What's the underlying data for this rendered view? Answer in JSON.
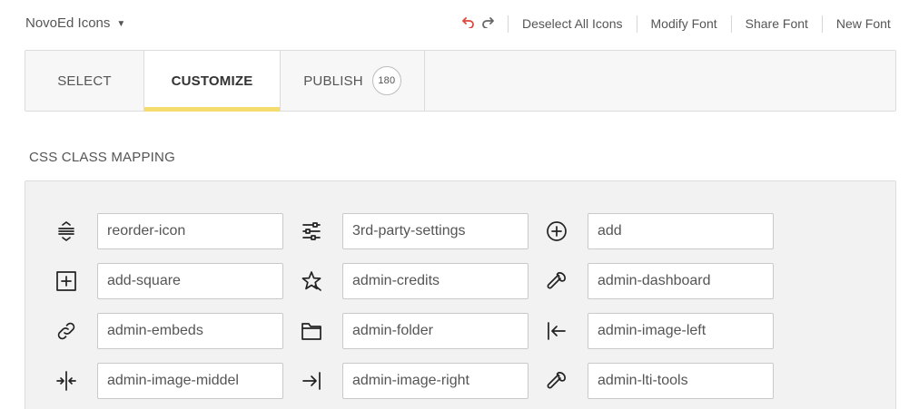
{
  "header": {
    "font_name": "NovoEd Icons",
    "menu": [
      "Deselect All Icons",
      "Modify Font",
      "Share Font",
      "New Font"
    ]
  },
  "colors": {
    "accent": "#f5dc6e",
    "undo": "#e0463c"
  },
  "tabs": {
    "select": "SELECT",
    "customize": "CUSTOMIZE",
    "publish": "PUBLISH",
    "publish_count": "180"
  },
  "mapping": {
    "title": "CSS CLASS MAPPING",
    "items": [
      {
        "icon": "reorder-icon",
        "class_name": "reorder-icon"
      },
      {
        "icon": "settings-sliders-icon",
        "class_name": "3rd-party-settings"
      },
      {
        "icon": "plus-circle-icon",
        "class_name": "add"
      },
      {
        "icon": "plus-square-icon",
        "class_name": "add-square"
      },
      {
        "icon": "star-credits-icon",
        "class_name": "admin-credits"
      },
      {
        "icon": "wrench-icon",
        "class_name": "admin-dashboard"
      },
      {
        "icon": "link-icon",
        "class_name": "admin-embeds"
      },
      {
        "icon": "folder-icon",
        "class_name": "admin-folder"
      },
      {
        "icon": "arrow-left-bar-icon",
        "class_name": "admin-image-left"
      },
      {
        "icon": "align-middle-icon",
        "class_name": "admin-image-middel"
      },
      {
        "icon": "arrow-right-bar-icon",
        "class_name": "admin-image-right"
      },
      {
        "icon": "wrench-icon",
        "class_name": "admin-lti-tools"
      }
    ]
  }
}
